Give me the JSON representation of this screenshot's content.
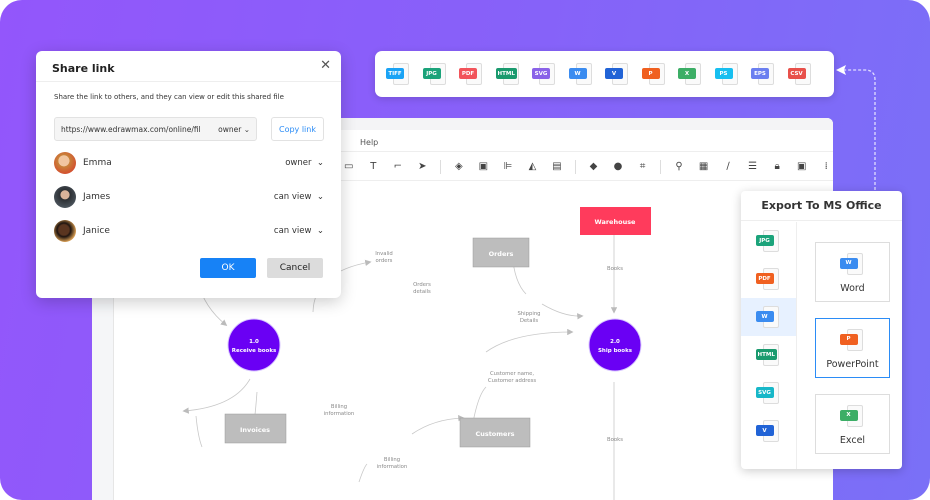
{
  "colors": {
    "accent": "#1782f6",
    "process": "#6a00f4",
    "warehouse": "#ff3b5c",
    "store": "#bdbdbd",
    "bg_left": "#9356fb",
    "bg_right": "#7a70f7"
  },
  "formats_bar": [
    {
      "label": "TIFF",
      "color": "#1aa3f5"
    },
    {
      "label": "JPG",
      "color": "#1ba37a"
    },
    {
      "label": "PDF",
      "color": "#f2545b"
    },
    {
      "label": "HTML",
      "color": "#1a9a6e"
    },
    {
      "label": "SVG",
      "color": "#8a62e8"
    },
    {
      "label": "W",
      "color": "#3b8cf0"
    },
    {
      "label": "V",
      "color": "#2163d6"
    },
    {
      "label": "P",
      "color": "#f06020"
    },
    {
      "label": "X",
      "color": "#3cae66"
    },
    {
      "label": "PS",
      "color": "#17bff0"
    },
    {
      "label": "EPS",
      "color": "#6b7ff0"
    },
    {
      "label": "CSV",
      "color": "#e8504a"
    }
  ],
  "editor": {
    "menu_help": "Help",
    "toolbar_icons": [
      "rectangle-icon",
      "text-icon",
      "connector-icon",
      "pointer-icon",
      "layers-icon",
      "group-icon",
      "align-icon",
      "flip-icon",
      "frame-icon",
      "fill-icon",
      "shadow-icon",
      "crop-icon",
      "search-icon",
      "table-icon",
      "line-color-icon",
      "line-style-icon",
      "lock-icon",
      "fit-icon",
      "more-icon"
    ]
  },
  "diagram": {
    "warehouse": "Warehouse",
    "orders": "Orders",
    "invoices": "Invoices",
    "customers": "Customers",
    "p1_num": "1.0",
    "p1_name": "Receive books",
    "p2_num": "2.0",
    "p2_name": "Ship books",
    "l_invalid": [
      "Invalid",
      "orders"
    ],
    "l_orders_details": [
      "Orders",
      "details"
    ],
    "l_books1": "Books",
    "l_shipping": [
      "Shipping",
      "Details"
    ],
    "l_customer": [
      "Customer name,",
      "Customer address"
    ],
    "l_billing1": [
      "Billing",
      "information"
    ],
    "l_billing2": [
      "Billing",
      "information"
    ],
    "l_books2": "Books"
  },
  "share": {
    "title": "Share link",
    "description": "Share the link to others, and they can view or edit this shared file",
    "link_value": "https://www.edrawmax.com/online/fil",
    "link_permission": "owner",
    "copy_label": "Copy link",
    "users": [
      {
        "name": "Emma",
        "role": "owner",
        "avatar": "#c8833a"
      },
      {
        "name": "James",
        "role": "can view",
        "avatar": "#3a3f44"
      },
      {
        "name": "Janice",
        "role": "can view",
        "avatar": "#d49a50"
      }
    ],
    "ok_label": "OK",
    "cancel_label": "Cancel"
  },
  "export": {
    "title": "Export To MS Office",
    "side": [
      {
        "label": "JPG",
        "color": "#1ba37a"
      },
      {
        "label": "PDF",
        "color": "#f06020"
      },
      {
        "label": "W",
        "color": "#3b8cf0",
        "selected": true
      },
      {
        "label": "HTML",
        "color": "#1a9a6e"
      },
      {
        "label": "SVG",
        "color": "#17b7c8"
      },
      {
        "label": "V",
        "color": "#2163d6"
      }
    ],
    "cards": [
      {
        "label": "Word",
        "icon": "W",
        "color": "#3b8cf0"
      },
      {
        "label": "PowerPoint",
        "icon": "P",
        "color": "#f06020",
        "selected": true
      },
      {
        "label": "Excel",
        "icon": "X",
        "color": "#3cae66"
      }
    ]
  }
}
